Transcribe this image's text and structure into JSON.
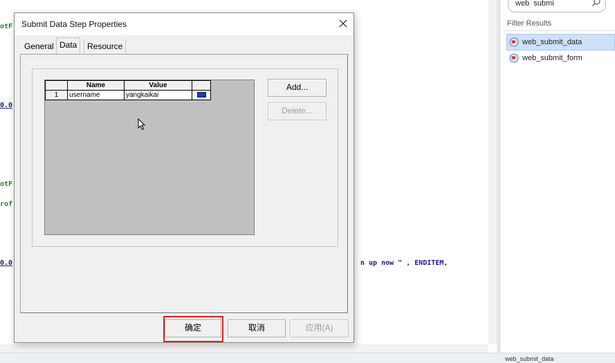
{
  "editor": {
    "lines": [
      {
        "text": "otF",
        "color": "green"
      },
      {
        "text": "0.0",
        "color": "blue"
      },
      {
        "text": "otF",
        "color": "green"
      },
      {
        "text": "rof",
        "color": "green"
      },
      {
        "text": "0.0",
        "color": "blue"
      }
    ],
    "fragment_str": "n up now \"",
    "fragment_kw": ", ENDITEM,"
  },
  "right_panel": {
    "search_value": "web  submi",
    "filter_title": "Filter Results",
    "results": [
      {
        "label": "web_submit_data",
        "selected": true
      },
      {
        "label": "web_submit_form",
        "selected": false
      }
    ],
    "bottom_fragment": "web_submit_data"
  },
  "dialog": {
    "title": "Submit Data Step Properties",
    "tabs": [
      {
        "label": "General"
      },
      {
        "label": "Data"
      },
      {
        "label": "Resource"
      }
    ],
    "active_tab": "Data",
    "grid": {
      "headers": [
        "Name",
        "Value"
      ],
      "rows": [
        {
          "index": "1",
          "name": "username",
          "value": "yangkaikai",
          "icon": "abc-icon"
        }
      ]
    },
    "buttons": {
      "add": "Add...",
      "delete": "Delete...",
      "ok": "确定",
      "cancel": "取消",
      "apply": "应用(A)"
    },
    "colors": {
      "highlight": "#e0201f"
    }
  }
}
